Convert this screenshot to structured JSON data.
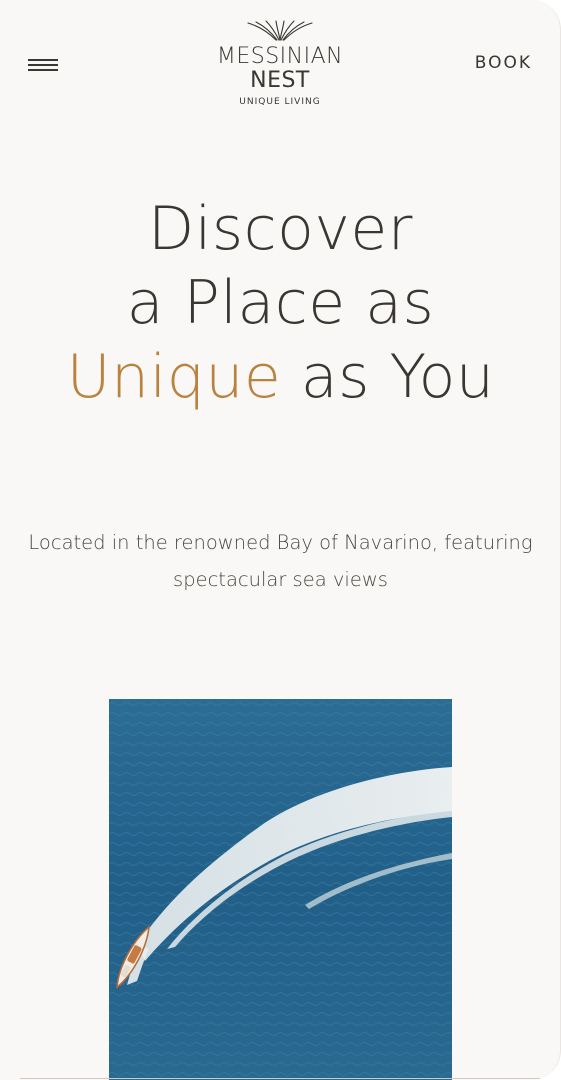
{
  "header": {
    "menu_icon": "hamburger-menu-icon",
    "logo": {
      "line1": "MESSINIAN",
      "line2": "NEST",
      "tagline": "UNIQUE LIVING"
    },
    "book_label": "BOOK"
  },
  "hero": {
    "title_line1": "Discover",
    "title_line2": "a Place as",
    "title_accent": "Unique",
    "title_line3_rest": " as You",
    "subtitle": "Located in the renowned Bay of Navarino, featuring spectacular sea views"
  },
  "colors": {
    "background": "#f9f8f6",
    "text": "#3a3632",
    "accent": "#b9823f",
    "sea": "#1f5f86"
  }
}
